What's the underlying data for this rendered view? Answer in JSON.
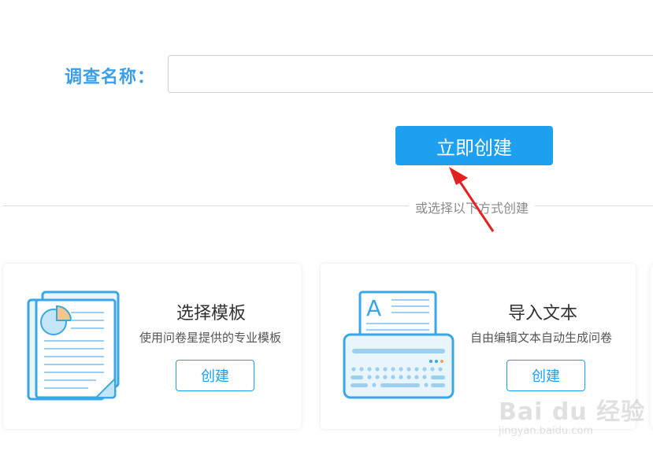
{
  "form": {
    "name_label": "调查名称：",
    "name_value": "",
    "name_placeholder": "",
    "create_now_label": "立即创建"
  },
  "divider": {
    "text": "或选择以下方式创建"
  },
  "annotation": {
    "arrow_color": "#e52020"
  },
  "cards": [
    {
      "title": "选择模板",
      "description": "使用问卷星提供的专业模板",
      "button_label": "创建",
      "icon": "template-document-icon"
    },
    {
      "title": "导入文本",
      "description": "自由编辑文本自动生成问卷",
      "button_label": "创建",
      "icon": "import-text-typewriter-icon",
      "icon_letter": "A"
    }
  ],
  "watermark": {
    "main": "Bai du 经验",
    "sub": "jingyan.baidu.com"
  },
  "colors": {
    "accent": "#1ea0f0",
    "label_blue": "#3a9ee8",
    "icon_outline": "#3aa6e6",
    "icon_fill": "#e9f5fd",
    "icon_orange": "#f6c58e"
  }
}
